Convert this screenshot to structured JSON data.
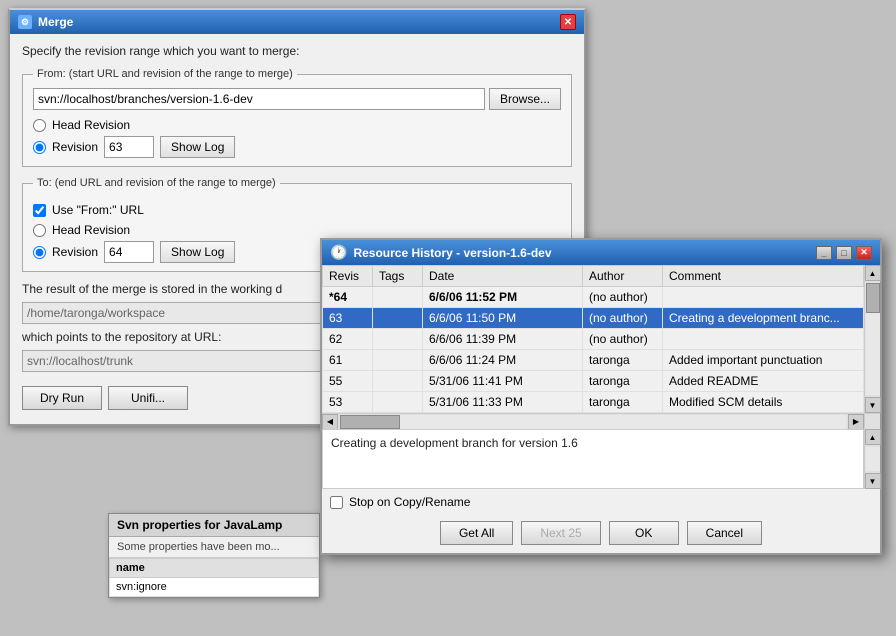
{
  "merge_dialog": {
    "title": "Merge",
    "subtitle": "Specify the revision range which you want to merge:",
    "from_legend": "From: (start URL and revision of the range to merge)",
    "from_url": "svn://localhost/branches/version-1.6-dev",
    "browse_label": "Browse...",
    "head_revision_label": "Head Revision",
    "revision_label": "Revision",
    "revision1_value": "63",
    "show_log1_label": "Show Log",
    "to_legend": "To: (end URL and revision of the range to merge)",
    "use_from_label": "Use \"From:\" URL",
    "head_revision2_label": "Head Revision",
    "revision2_label": "Revision",
    "revision2_value": "64",
    "show_log2_label": "Show Log",
    "result_text": "The result of the merge is stored in the working d",
    "working_dir": "/home/taronga/workspace",
    "repo_url_label": "which points to the repository at URL:",
    "repo_url": "svn://localhost/trunk",
    "dry_run_label": "Dry Run",
    "unifi_label": "Unifi..."
  },
  "svn_panel": {
    "title": "Svn properties for JavaLamp",
    "message": "Some properties have been mo...",
    "col_name": "name",
    "row1": "svn:ignore"
  },
  "resource_history": {
    "title": "Resource History - version-1.6-dev",
    "col_revision": "Revis",
    "col_tags": "Tags",
    "col_date": "Date",
    "col_author": "Author",
    "col_comment": "Comment",
    "rows": [
      {
        "revision": "*64",
        "tags": "",
        "date": "6/6/06 11:52 PM",
        "author": "(no author)",
        "comment": "",
        "selected": false,
        "current": true,
        "bold_date": true
      },
      {
        "revision": "63",
        "tags": "",
        "date": "6/6/06 11:50 PM",
        "author": "(no author)",
        "comment": "Creating a development branc...",
        "selected": true,
        "current": false,
        "bold_date": false
      },
      {
        "revision": "62",
        "tags": "",
        "date": "6/6/06 11:39 PM",
        "author": "(no author)",
        "comment": "",
        "selected": false,
        "current": false,
        "bold_date": false
      },
      {
        "revision": "61",
        "tags": "",
        "date": "6/6/06 11:24 PM",
        "author": "taronga",
        "comment": "Added important punctuation",
        "selected": false,
        "current": false,
        "bold_date": false
      },
      {
        "revision": "55",
        "tags": "",
        "date": "5/31/06 11:41 PM",
        "author": "taronga",
        "comment": "Added README",
        "selected": false,
        "current": false,
        "bold_date": false
      },
      {
        "revision": "53",
        "tags": "",
        "date": "5/31/06 11:33 PM",
        "author": "taronga",
        "comment": "Modified SCM details",
        "selected": false,
        "current": false,
        "bold_date": false
      }
    ],
    "log_message": "Creating a development branch for version 1.6",
    "stop_copy_label": "Stop on Copy/Rename",
    "get_all_label": "Get All",
    "next_25_label": "Next 25",
    "ok_label": "OK",
    "cancel_label": "Cancel"
  }
}
